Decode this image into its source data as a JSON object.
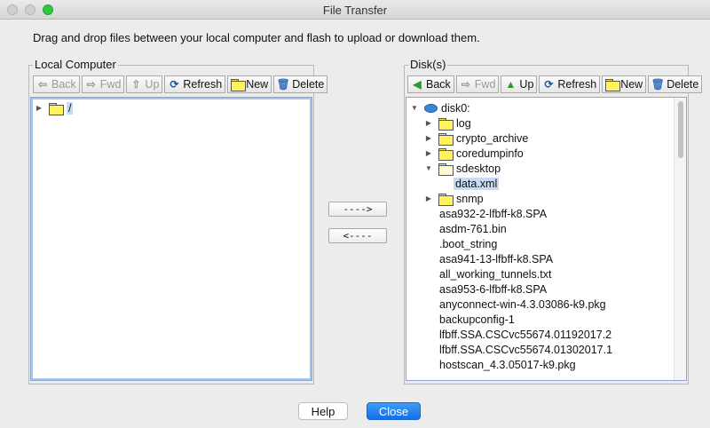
{
  "window": {
    "title": "File Transfer"
  },
  "instructions": "Drag and drop files between your local computer and flash to upload or download them.",
  "local": {
    "title": "Local Computer",
    "toolbar": {
      "back": "Back",
      "fwd": "Fwd",
      "up": "Up",
      "refresh": "Refresh",
      "new": "New",
      "delete": "Delete"
    },
    "tree": {
      "root": "/"
    }
  },
  "disk": {
    "title": "Disk(s)",
    "toolbar": {
      "back": "Back",
      "fwd": "Fwd",
      "up": "Up",
      "refresh": "Refresh",
      "new": "New",
      "delete": "Delete"
    },
    "tree": {
      "root": "disk0:",
      "folders": [
        "log",
        "crypto_archive",
        "coredumpinfo",
        "sdesktop"
      ],
      "sdesktop_child": "data.xml",
      "snmp": "snmp",
      "files": [
        "asa932-2-lfbff-k8.SPA",
        "asdm-761.bin",
        ".boot_string",
        "asa941-13-lfbff-k8.SPA",
        "all_working_tunnels.txt",
        "asa953-6-lfbff-k8.SPA",
        "anyconnect-win-4.3.03086-k9.pkg",
        "backupconfig-1",
        "lfbff.SSA.CSCvc55674.01192017.2",
        "lfbff.SSA.CSCvc55674.01302017.1",
        "hostscan_4.3.05017-k9.pkg"
      ]
    }
  },
  "transfer": {
    "upload": "---->",
    "download": "<----"
  },
  "buttons": {
    "help": "Help",
    "close": "Close"
  },
  "colors": {
    "accent": "#1070e6",
    "selection": "#c6dbf7",
    "folder": "#fff25c"
  }
}
